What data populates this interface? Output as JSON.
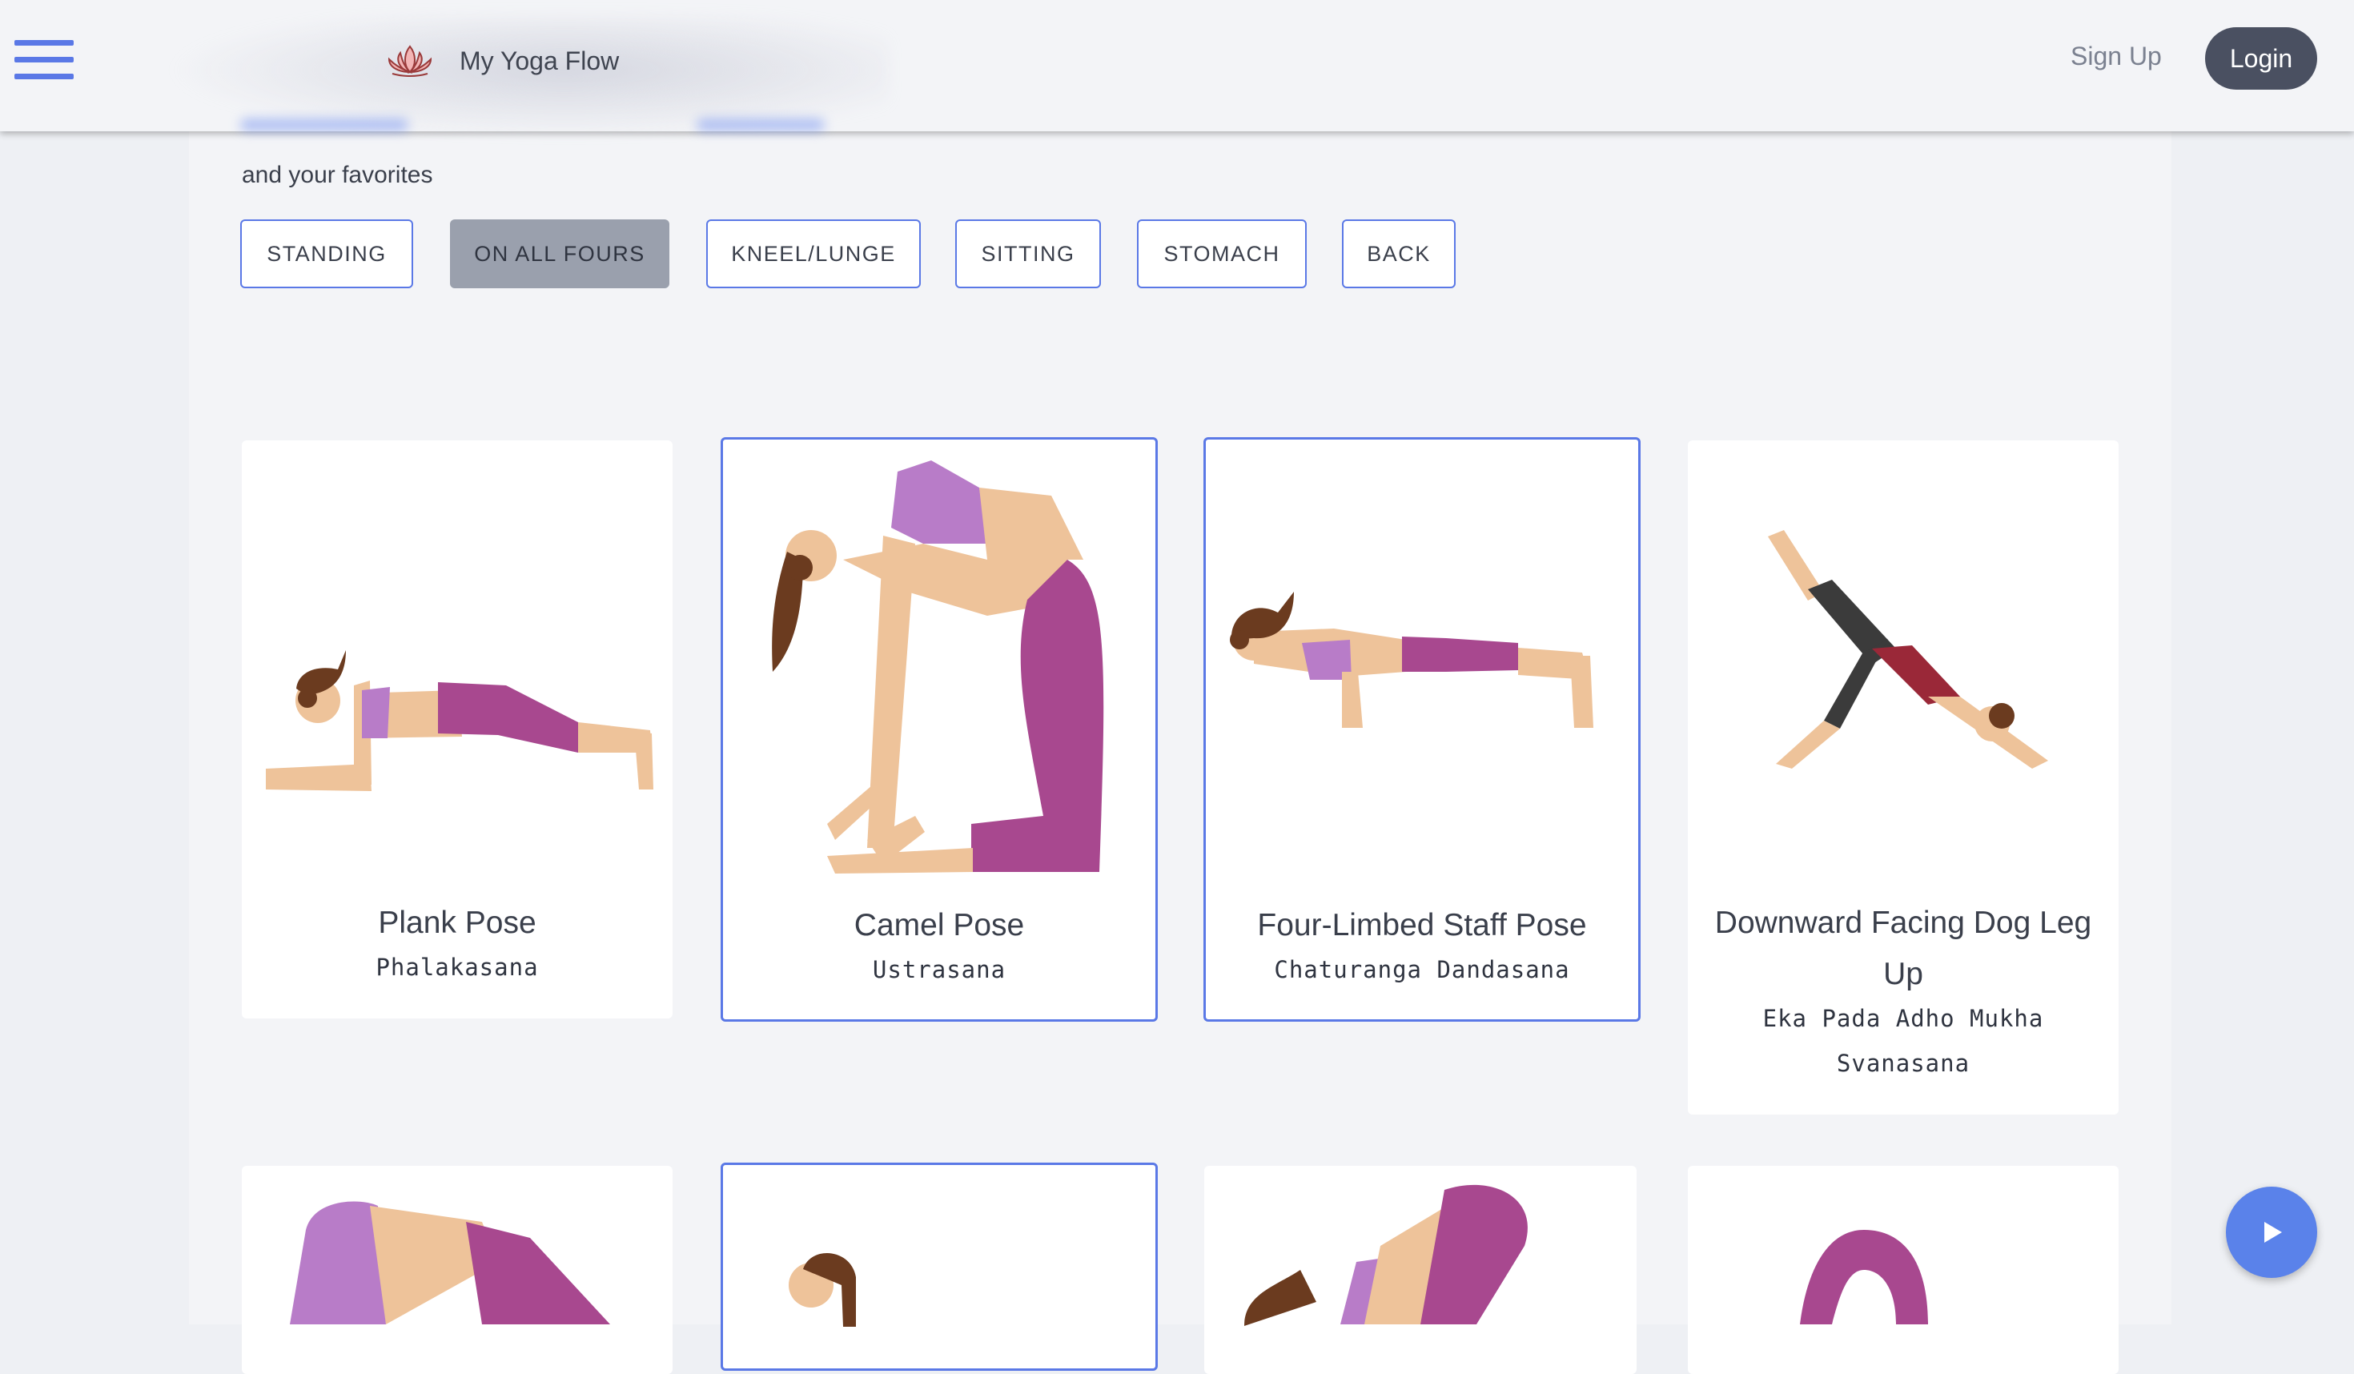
{
  "header": {
    "brand_name": "My Yoga Flow",
    "signup_label": "Sign Up",
    "login_label": "Login",
    "menu_icon": "hamburger-menu-icon",
    "logo_icon": "lotus-icon"
  },
  "intro": {
    "favorites_text": "and your favorites"
  },
  "filters": [
    {
      "label": "STANDING",
      "active": false
    },
    {
      "label": "ON ALL FOURS",
      "active": true
    },
    {
      "label": "KNEEL/LUNGE",
      "active": false
    },
    {
      "label": "SITTING",
      "active": false
    },
    {
      "label": "STOMACH",
      "active": false
    },
    {
      "label": "BACK",
      "active": false
    }
  ],
  "poses": [
    {
      "name": "Plank Pose",
      "sanskrit": "Phalakasana",
      "selected": false
    },
    {
      "name": "Camel Pose",
      "sanskrit": "Ustrasana",
      "selected": true
    },
    {
      "name": "Four-Limbed Staff Pose",
      "sanskrit": "Chaturanga Dandasana",
      "selected": true
    },
    {
      "name_line1": "Downward Facing Dog Leg",
      "name_line2": "Up",
      "sanskrit_line1": "Eka Pada Adho Mukha",
      "sanskrit_line2": "Svanasana",
      "selected": false
    }
  ],
  "second_row": [
    {
      "selected": false
    },
    {
      "selected": true
    },
    {
      "selected": false
    },
    {
      "selected": false
    }
  ],
  "fab": {
    "icon": "play-icon"
  },
  "colors": {
    "accent": "#5a78e6",
    "skin": "#eec39a",
    "purple": "#a8488f",
    "lilac": "#b87cc8",
    "hair": "#6b3b1f"
  }
}
